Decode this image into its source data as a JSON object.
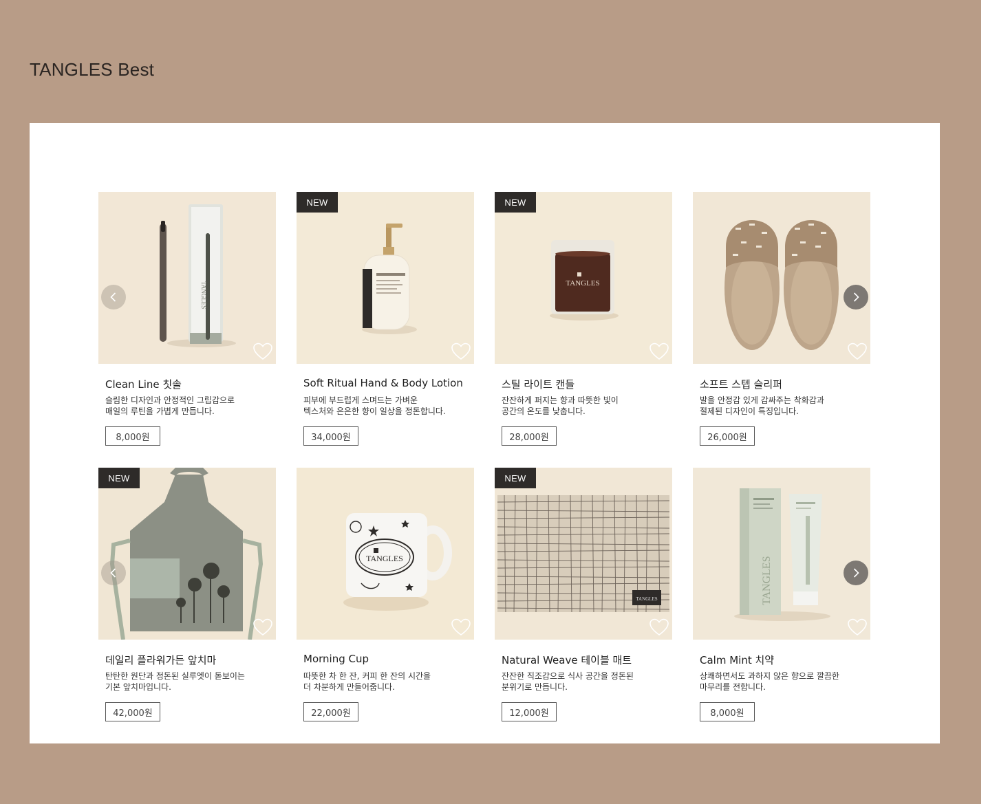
{
  "page": {
    "title": "TANGLES Best",
    "background_color": "#b89c87",
    "panel_color": "#ffffff"
  },
  "badge_label": "NEW",
  "products": [
    {
      "name": "Clean Line 칫솔",
      "desc1": "슬림한 디자인과 안정적인 그립감으로",
      "desc2": "매일의 루틴을 가볍게 만듭니다.",
      "price": "8,000원",
      "is_new": false,
      "image": "toothbrush"
    },
    {
      "name": "Soft Ritual Hand & Body Lotion",
      "desc1": "피부에 부드럽게 스며드는 가벼운",
      "desc2": "텍스처와 은은한 향이 일상을 정돈합니다.",
      "price": "34,000원",
      "is_new": true,
      "image": "lotion-bottle"
    },
    {
      "name": "스틸 라이트 캔들",
      "desc1": "잔잔하게 퍼지는 향과 따뜻한 빛이",
      "desc2": "공간의 온도를 낮춥니다.",
      "price": "28,000원",
      "is_new": true,
      "image": "candle"
    },
    {
      "name": "소프트 스텝 슬리퍼",
      "desc1": "발을 안정감 있게 감싸주는 착화감과",
      "desc2": "절제된 디자인이 특징입니다.",
      "price": "26,000원",
      "is_new": false,
      "image": "slippers"
    },
    {
      "name": "데일리 플라워가든 앞치마",
      "desc1": "탄탄한 원단과 정돈된 실루엣이 돋보이는",
      "desc2": "기본 앞치마입니다.",
      "price": "42,000원",
      "is_new": true,
      "image": "apron"
    },
    {
      "name": "Morning Cup",
      "desc1": "따뜻한 차 한 잔, 커피 한 잔의 시간을",
      "desc2": "더 차분하게 만들어줍니다.",
      "price": "22,000원",
      "is_new": false,
      "image": "mug"
    },
    {
      "name": "Natural Weave 테이블 매트",
      "desc1": "잔잔한 직조감으로 식사 공간을 정돈된",
      "desc2": "분위기로 만듭니다.",
      "price": "12,000원",
      "is_new": true,
      "image": "table-mat"
    },
    {
      "name": "Calm Mint 치약",
      "desc1": "상쾌하면서도 과하지 않은 향으로 깔끔한",
      "desc2": "마무리를 전합니다.",
      "price": "8,000원",
      "is_new": false,
      "image": "toothpaste"
    }
  ],
  "brand_mark": "TANGLES",
  "icons": {
    "prev": "chevron-left-icon",
    "next": "chevron-right-icon",
    "wishlist": "heart-icon"
  }
}
